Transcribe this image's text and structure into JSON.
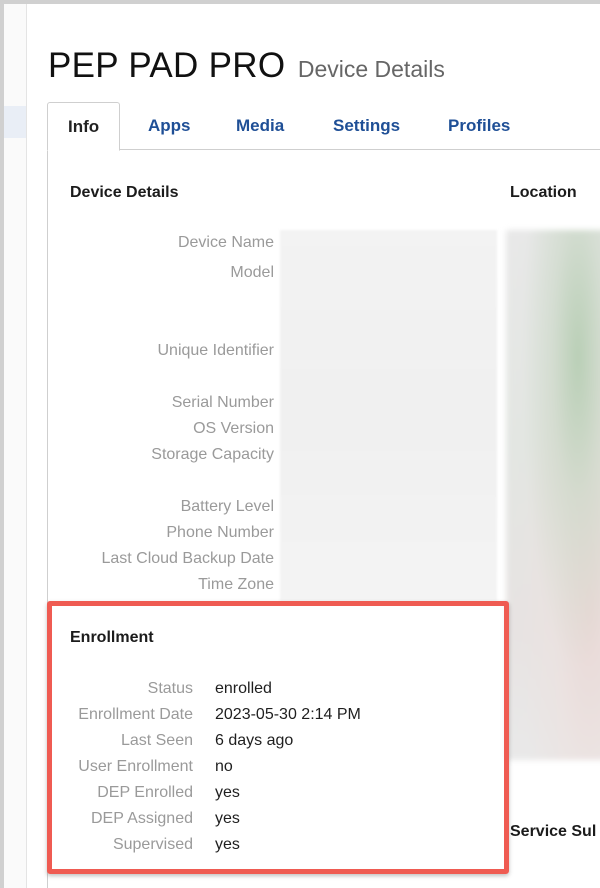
{
  "header": {
    "device_name": "PEP PAD PRO",
    "subtitle": "Device Details"
  },
  "tabs": [
    {
      "label": "Info",
      "active": true
    },
    {
      "label": "Apps",
      "active": false
    },
    {
      "label": "Media",
      "active": false
    },
    {
      "label": "Settings",
      "active": false
    },
    {
      "label": "Profiles",
      "active": false
    }
  ],
  "device_details": {
    "title": "Device Details",
    "labels": [
      "Device Name",
      "Model",
      "Unique Identifier",
      "Serial Number",
      "OS Version",
      "Storage Capacity",
      "Battery Level",
      "Phone Number",
      "Last Cloud Backup Date",
      "Time Zone"
    ]
  },
  "location": {
    "title": "Location"
  },
  "service_subscriptions": {
    "title": "Service Sul"
  },
  "enrollment": {
    "title": "Enrollment",
    "rows": [
      {
        "label": "Status",
        "value": "enrolled"
      },
      {
        "label": "Enrollment Date",
        "value": "2023-05-30 2:14 PM"
      },
      {
        "label": "Last Seen",
        "value": "6 days ago"
      },
      {
        "label": "User Enrollment",
        "value": "no"
      },
      {
        "label": "DEP Enrolled",
        "value": "yes"
      },
      {
        "label": "DEP Assigned",
        "value": "yes"
      },
      {
        "label": "Supervised",
        "value": "yes"
      }
    ]
  },
  "colors": {
    "highlight": "#ef5b52",
    "tab_link": "#1f4f96"
  }
}
